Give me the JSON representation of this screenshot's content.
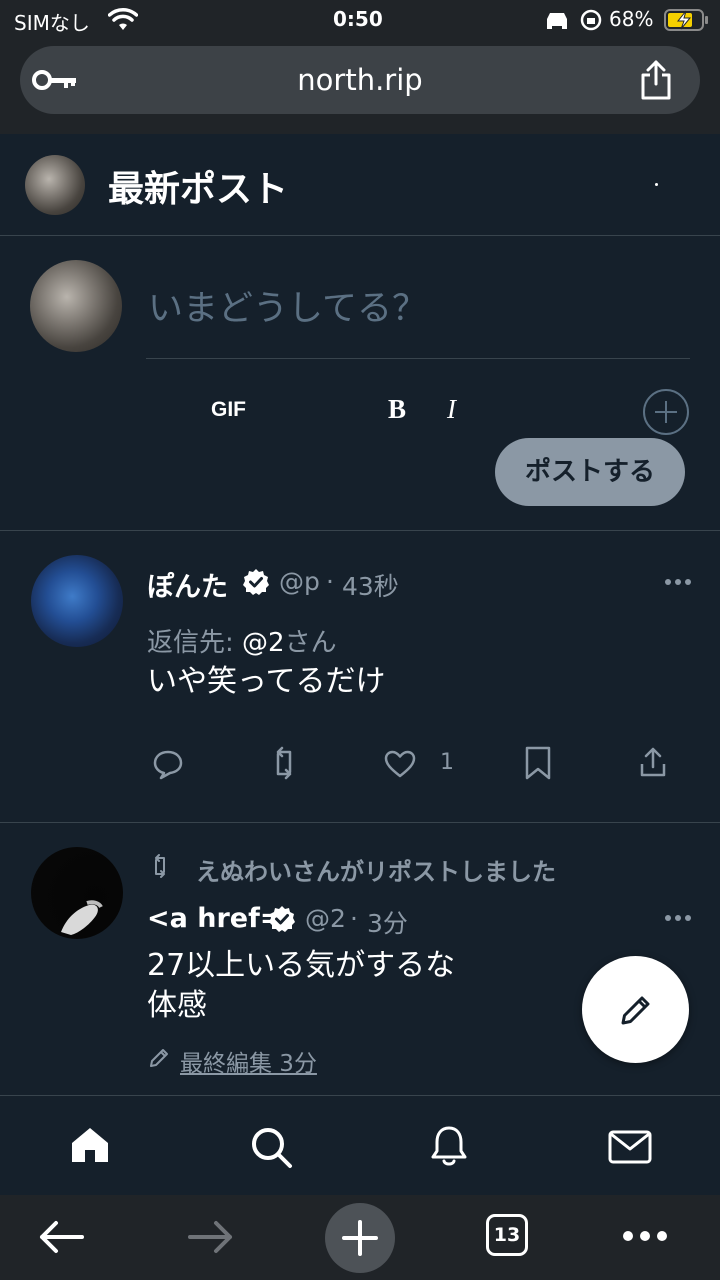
{
  "status_bar": {
    "carrier": "SIMなし",
    "time": "0:50",
    "battery": "68%"
  },
  "browser": {
    "url": "north.rip",
    "tab_count": "13"
  },
  "header": {
    "title": "最新ポスト"
  },
  "composer": {
    "placeholder": "いまどうしてる？",
    "gif_label": "GIF",
    "bold_label": "B",
    "italic_label": "I",
    "post_button": "ポストする"
  },
  "posts": [
    {
      "display_name": "ぽんた",
      "handle": "@p",
      "time": "43秒",
      "reply_prefix": "返信先: ",
      "reply_to": "@2",
      "reply_suffix": "さん",
      "text": "いや笑ってるだけ",
      "like_count": "1"
    },
    {
      "repost_label": "えぬわいさんがリポストしました",
      "display_name": "<a href=",
      "handle": "@2",
      "time": "3分",
      "text_line1": "27以上いる気がするな",
      "text_line2": "体感",
      "edited_label": "最終編集 3分"
    }
  ],
  "colors": {
    "background": "#15202b",
    "secondary_text": "#8b98a5",
    "divider": "#38444d",
    "post_button": "#8b98a5"
  }
}
